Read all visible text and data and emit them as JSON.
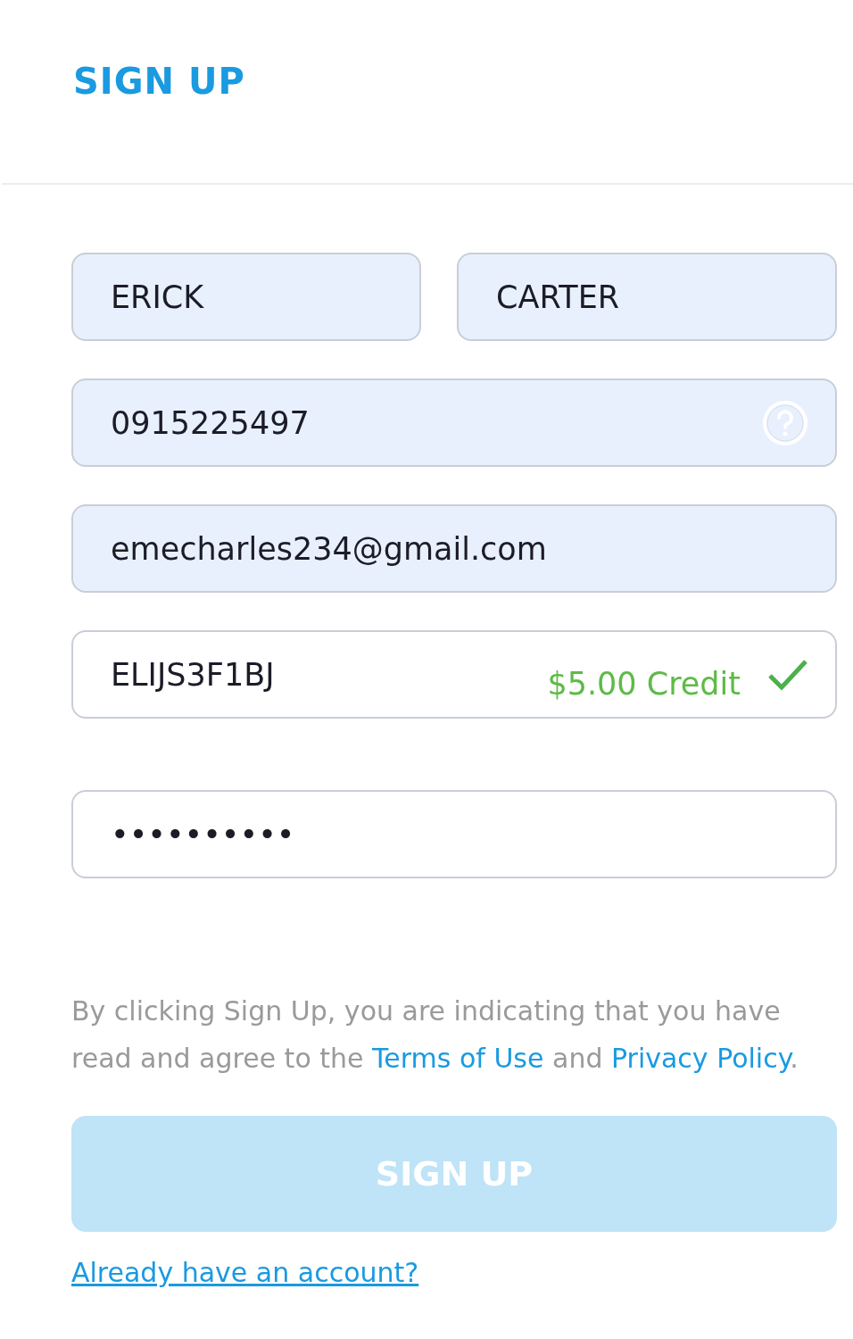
{
  "header": {
    "title": "SIGN UP"
  },
  "name_fields": [
    {
      "value": "ERICK",
      "autofilled": true
    },
    {
      "value": "CARTER",
      "autofilled": true
    }
  ],
  "fields": [
    {
      "kind": "phone",
      "value": "0915225497",
      "autofilled": true
    },
    {
      "kind": "email",
      "value": "emecharles234@gmail.com",
      "autofilled": true
    },
    {
      "kind": "promo",
      "value": "ELIJS3F1BJ",
      "autofilled": false,
      "credit": "$5.00 Credit",
      "valid": true
    },
    {
      "kind": "password",
      "value": "••••••••••",
      "autofilled": false
    }
  ],
  "terms": {
    "before": "By clicking Sign Up, you are indicating that you have read and agree to the",
    "terms_link": "Terms of Use",
    "middle": "and",
    "privacy_link": "Privacy Policy",
    "after": "."
  },
  "submit": {
    "label": "SIGN UP",
    "disabled": true
  },
  "login_link": "Already have an account?"
}
